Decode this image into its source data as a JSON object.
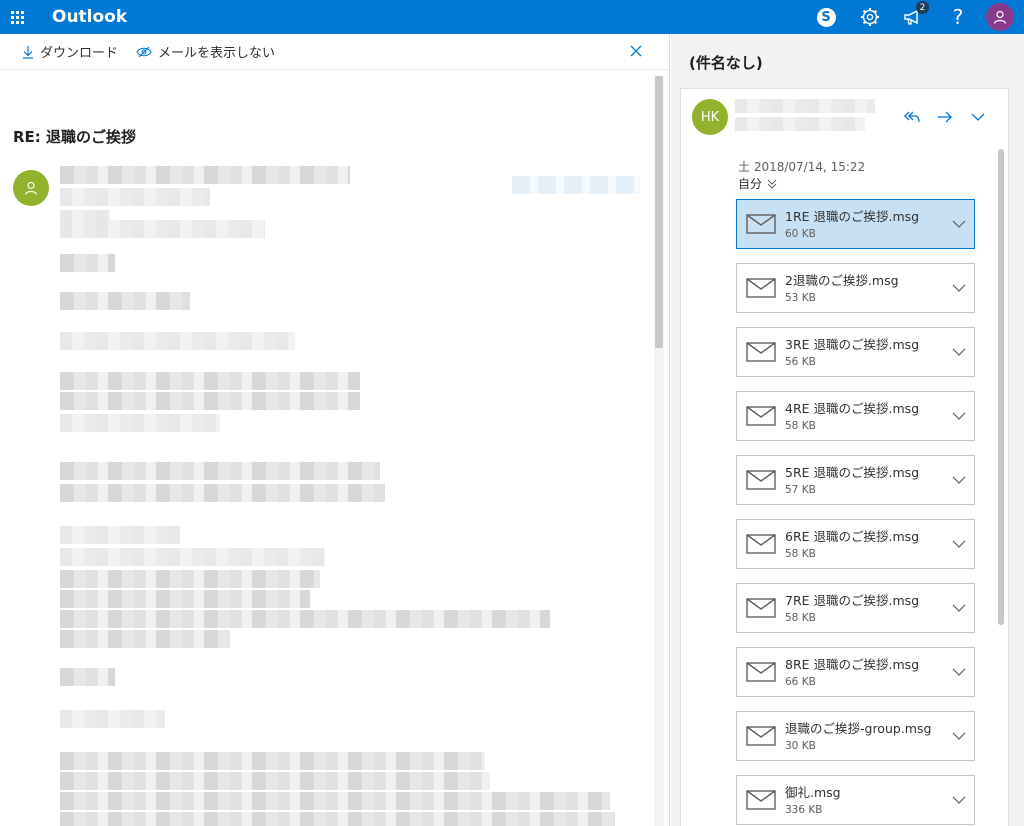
{
  "topbar": {
    "app_name": "Outlook",
    "skype_label": "S",
    "notification_count": "2",
    "help_label": "?",
    "accent": "#0078d4"
  },
  "toolbar": {
    "download_label": "ダウンロード",
    "hide_label": "メールを表示しない"
  },
  "message": {
    "subject": "RE: 退職のご挨拶"
  },
  "attachment_pane": {
    "title": "(件名なし)",
    "sender_initials": "HK",
    "date": "土 2018/07/14, 15:22",
    "recipient": "自分"
  },
  "attachments": [
    {
      "name": "1RE 退職のご挨拶.msg",
      "size": "60 KB",
      "selected": true
    },
    {
      "name": "2退職のご挨拶.msg",
      "size": "53 KB",
      "selected": false
    },
    {
      "name": "3RE 退職のご挨拶.msg",
      "size": "56 KB",
      "selected": false
    },
    {
      "name": "4RE 退職のご挨拶.msg",
      "size": "58 KB",
      "selected": false
    },
    {
      "name": "5RE 退職のご挨拶.msg",
      "size": "57 KB",
      "selected": false
    },
    {
      "name": "6RE 退職のご挨拶.msg",
      "size": "58 KB",
      "selected": false
    },
    {
      "name": "7RE 退職のご挨拶.msg",
      "size": "58 KB",
      "selected": false
    },
    {
      "name": "8RE 退職のご挨拶.msg",
      "size": "66 KB",
      "selected": false
    },
    {
      "name": "退職のご挨拶-group.msg",
      "size": "30 KB",
      "selected": false
    },
    {
      "name": "御礼.msg",
      "size": "336 KB",
      "selected": false
    }
  ]
}
